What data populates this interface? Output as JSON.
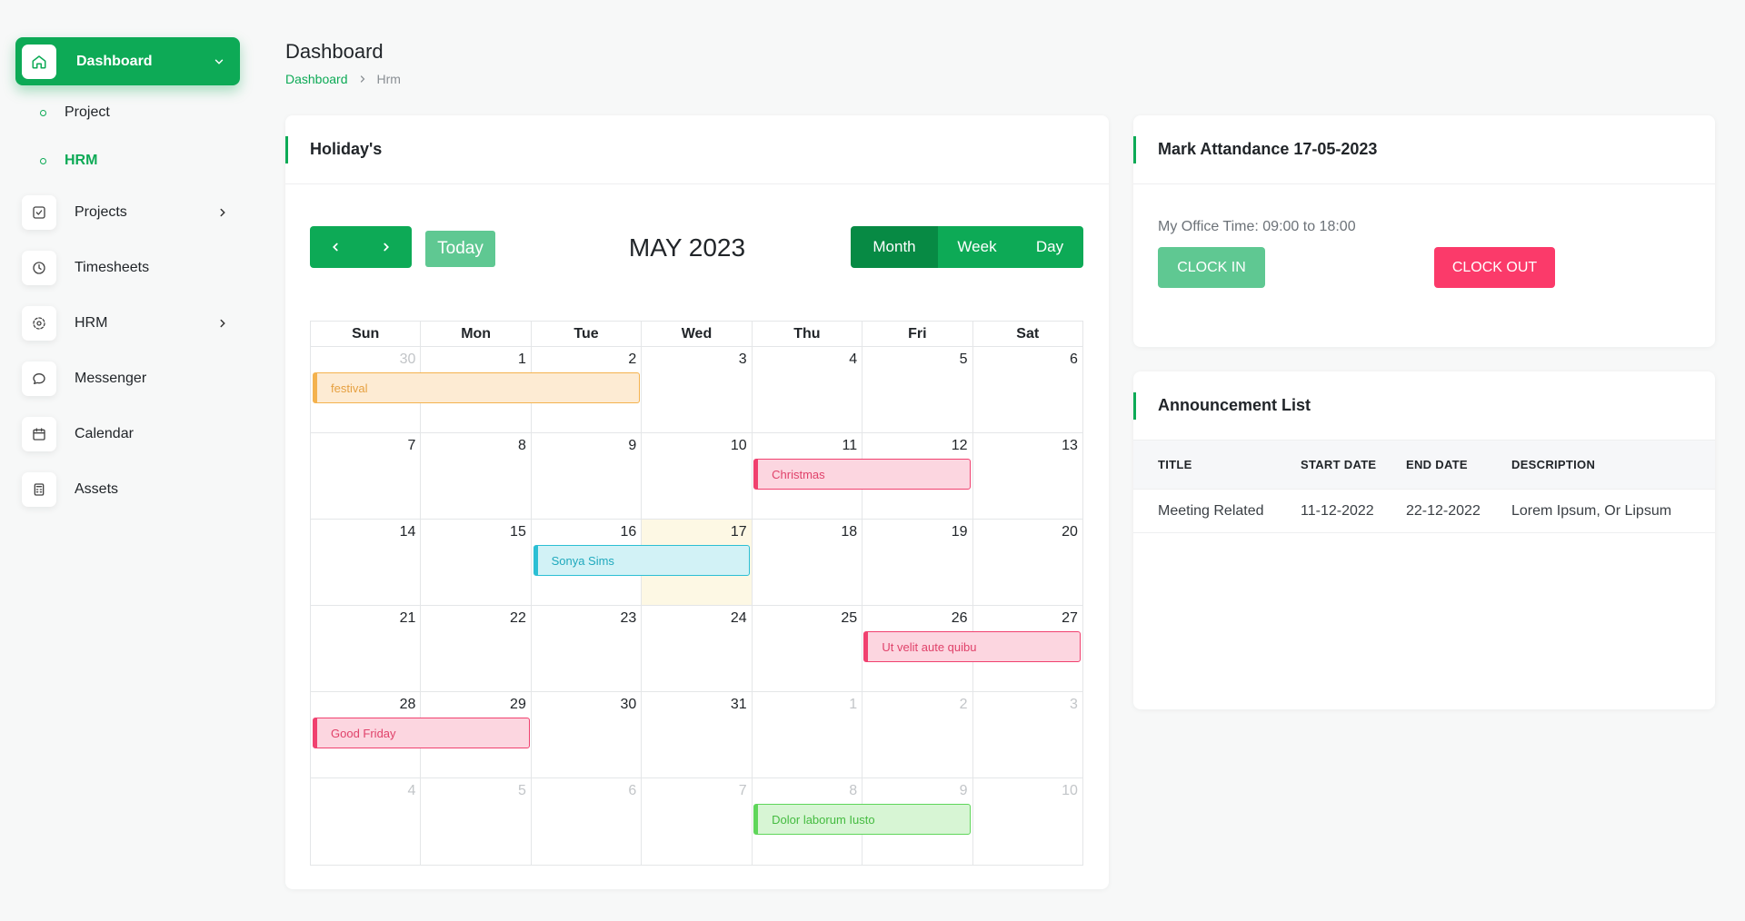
{
  "sidebar": {
    "active": {
      "label": "Dashboard",
      "icon": "home-icon"
    },
    "subitems": [
      {
        "label": "Project",
        "active": false
      },
      {
        "label": "HRM",
        "active": true
      }
    ],
    "items": [
      {
        "label": "Projects",
        "icon": "checkbox-icon",
        "has_children": true
      },
      {
        "label": "Timesheets",
        "icon": "clock-icon",
        "has_children": false
      },
      {
        "label": "HRM",
        "icon": "users-circle-icon",
        "has_children": true
      },
      {
        "label": "Messenger",
        "icon": "chat-icon",
        "has_children": false
      },
      {
        "label": "Calendar",
        "icon": "calendar-icon",
        "has_children": false
      },
      {
        "label": "Assets",
        "icon": "calculator-icon",
        "has_children": false
      }
    ]
  },
  "header": {
    "title": "Dashboard",
    "breadcrumb": {
      "link": "Dashboard",
      "current": "Hrm"
    }
  },
  "calendar": {
    "card_title": "Holiday's",
    "today_label": "Today",
    "month_title": "MAY 2023",
    "views": [
      "Month",
      "Week",
      "Day"
    ],
    "active_view": "Month",
    "weekdays": [
      "Sun",
      "Mon",
      "Tue",
      "Wed",
      "Thu",
      "Fri",
      "Sat"
    ],
    "weeks": [
      [
        "30",
        "1",
        "2",
        "3",
        "4",
        "5",
        "6"
      ],
      [
        "7",
        "8",
        "9",
        "10",
        "11",
        "12",
        "13"
      ],
      [
        "14",
        "15",
        "16",
        "17",
        "18",
        "19",
        "20"
      ],
      [
        "21",
        "22",
        "23",
        "24",
        "25",
        "26",
        "27"
      ],
      [
        "28",
        "29",
        "30",
        "31",
        "1",
        "2",
        "3"
      ],
      [
        "4",
        "5",
        "6",
        "7",
        "8",
        "9",
        "10"
      ]
    ],
    "events": [
      {
        "title": "festival",
        "week": 0,
        "start": 0,
        "span": 3,
        "color": "orange"
      },
      {
        "title": "Christmas",
        "week": 1,
        "start": 4,
        "span": 2,
        "color": "pink"
      },
      {
        "title": "Sonya Sims",
        "week": 2,
        "start": 2,
        "span": 2,
        "color": "cyan"
      },
      {
        "title": "Ut velit aute quibu",
        "week": 3,
        "start": 5,
        "span": 2,
        "color": "pink"
      },
      {
        "title": "Good Friday",
        "week": 4,
        "start": 0,
        "span": 2,
        "color": "pink"
      },
      {
        "title": "Dolor laborum Iusto",
        "week": 5,
        "start": 4,
        "span": 2,
        "color": "green"
      }
    ]
  },
  "attendance": {
    "title": "Mark Attandance 17-05-2023",
    "office_time": "My Office Time: 09:00 to 18:00",
    "clock_in": "CLOCK IN",
    "clock_out": "CLOCK OUT"
  },
  "announcements": {
    "title": "Announcement List",
    "columns": [
      "TITLE",
      "START DATE",
      "END DATE",
      "DESCRIPTION"
    ],
    "rows": [
      [
        "Meeting Related",
        "11-12-2022",
        "22-12-2022",
        "Lorem Ipsum, Or Lipsum"
      ]
    ]
  },
  "colors": {
    "primary": "#0daa56",
    "primary_dark": "#078a44",
    "danger": "#fb3a6a"
  }
}
